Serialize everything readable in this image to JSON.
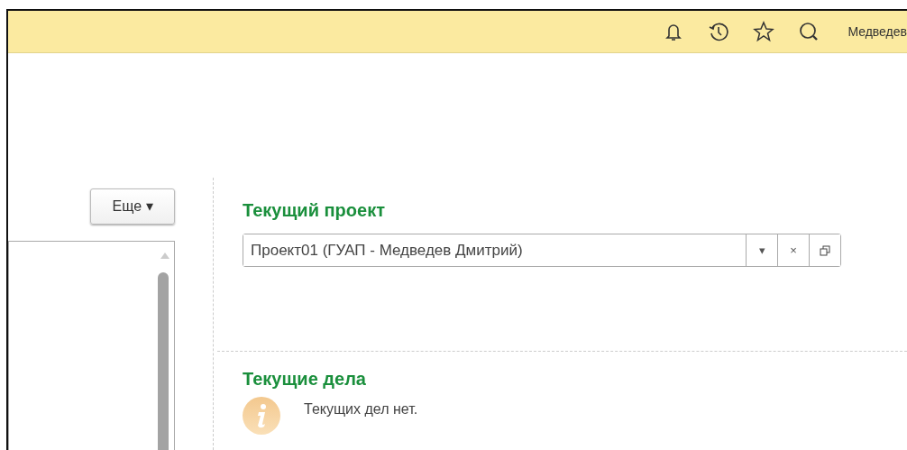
{
  "toolbar": {
    "user": "Медведев"
  },
  "left_panel": {
    "more_button": "Еще ▾"
  },
  "current_project": {
    "title": "Текущий проект",
    "value": "Проект01 (ГУАП - Медведев Дмитрий)",
    "dropdown": "▾",
    "clear": "×"
  },
  "current_tasks": {
    "title": "Текущие дела",
    "message": "Текущих дел нет."
  }
}
